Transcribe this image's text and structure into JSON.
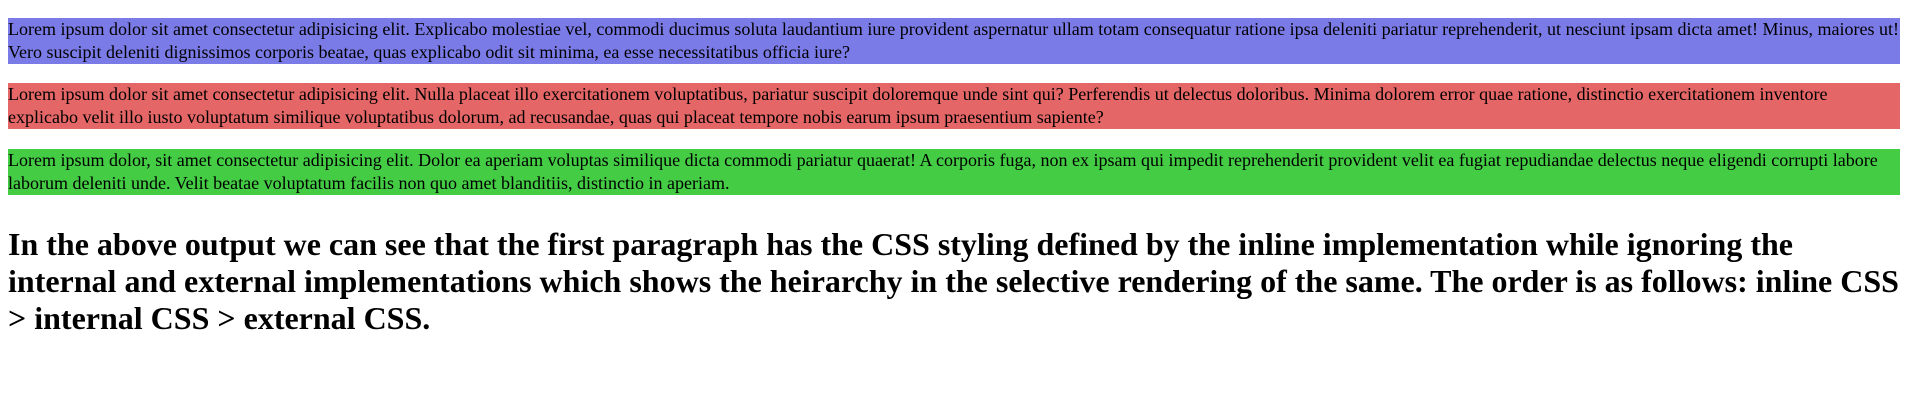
{
  "paragraphs": [
    {
      "text": "Lorem ipsum dolor sit amet consectetur adipisicing elit. Explicabo molestiae vel, commodi ducimus soluta laudantium iure provident aspernatur ullam totam consequatur ratione ipsa deleniti pariatur reprehenderit, ut nesciunt ipsam dicta amet! Minus, maiores ut! Vero suscipit deleniti dignissimos corporis beatae, quas explicabo odit sit minima, ea esse necessitatibus officia iure?",
      "background": "#7b7be8"
    },
    {
      "text": "Lorem ipsum dolor sit amet consectetur adipisicing elit. Nulla placeat illo exercitationem voluptatibus, pariatur suscipit doloremque unde sint qui? Perferendis ut delectus doloribus. Minima dolorem error quae ratione, distinctio exercitationem inventore explicabo velit illo iusto voluptatum similique voluptatibus dolorum, ad recusandae, quas qui placeat tempore nobis earum ipsum praesentium sapiente?",
      "background": "#e56666"
    },
    {
      "text": "Lorem ipsum dolor, sit amet consectetur adipisicing elit. Dolor ea aperiam voluptas similique dicta commodi pariatur quaerat! A corporis fuga, non ex ipsam qui impedit reprehenderit provident velit ea fugiat repudiandae delectus neque eligendi corrupti labore laborum deleniti unde. Velit beatae voluptatum facilis non quo amet blanditiis, distinctio in aperiam.",
      "background": "#44cc44"
    }
  ],
  "heading": "In the above output we can see that the first paragraph has the CSS styling defined by the inline implementation while ignoring the internal and external implementations which shows the heirarchy in the selective rendering of the same. The order is as follows: inline CSS > internal CSS > external CSS."
}
